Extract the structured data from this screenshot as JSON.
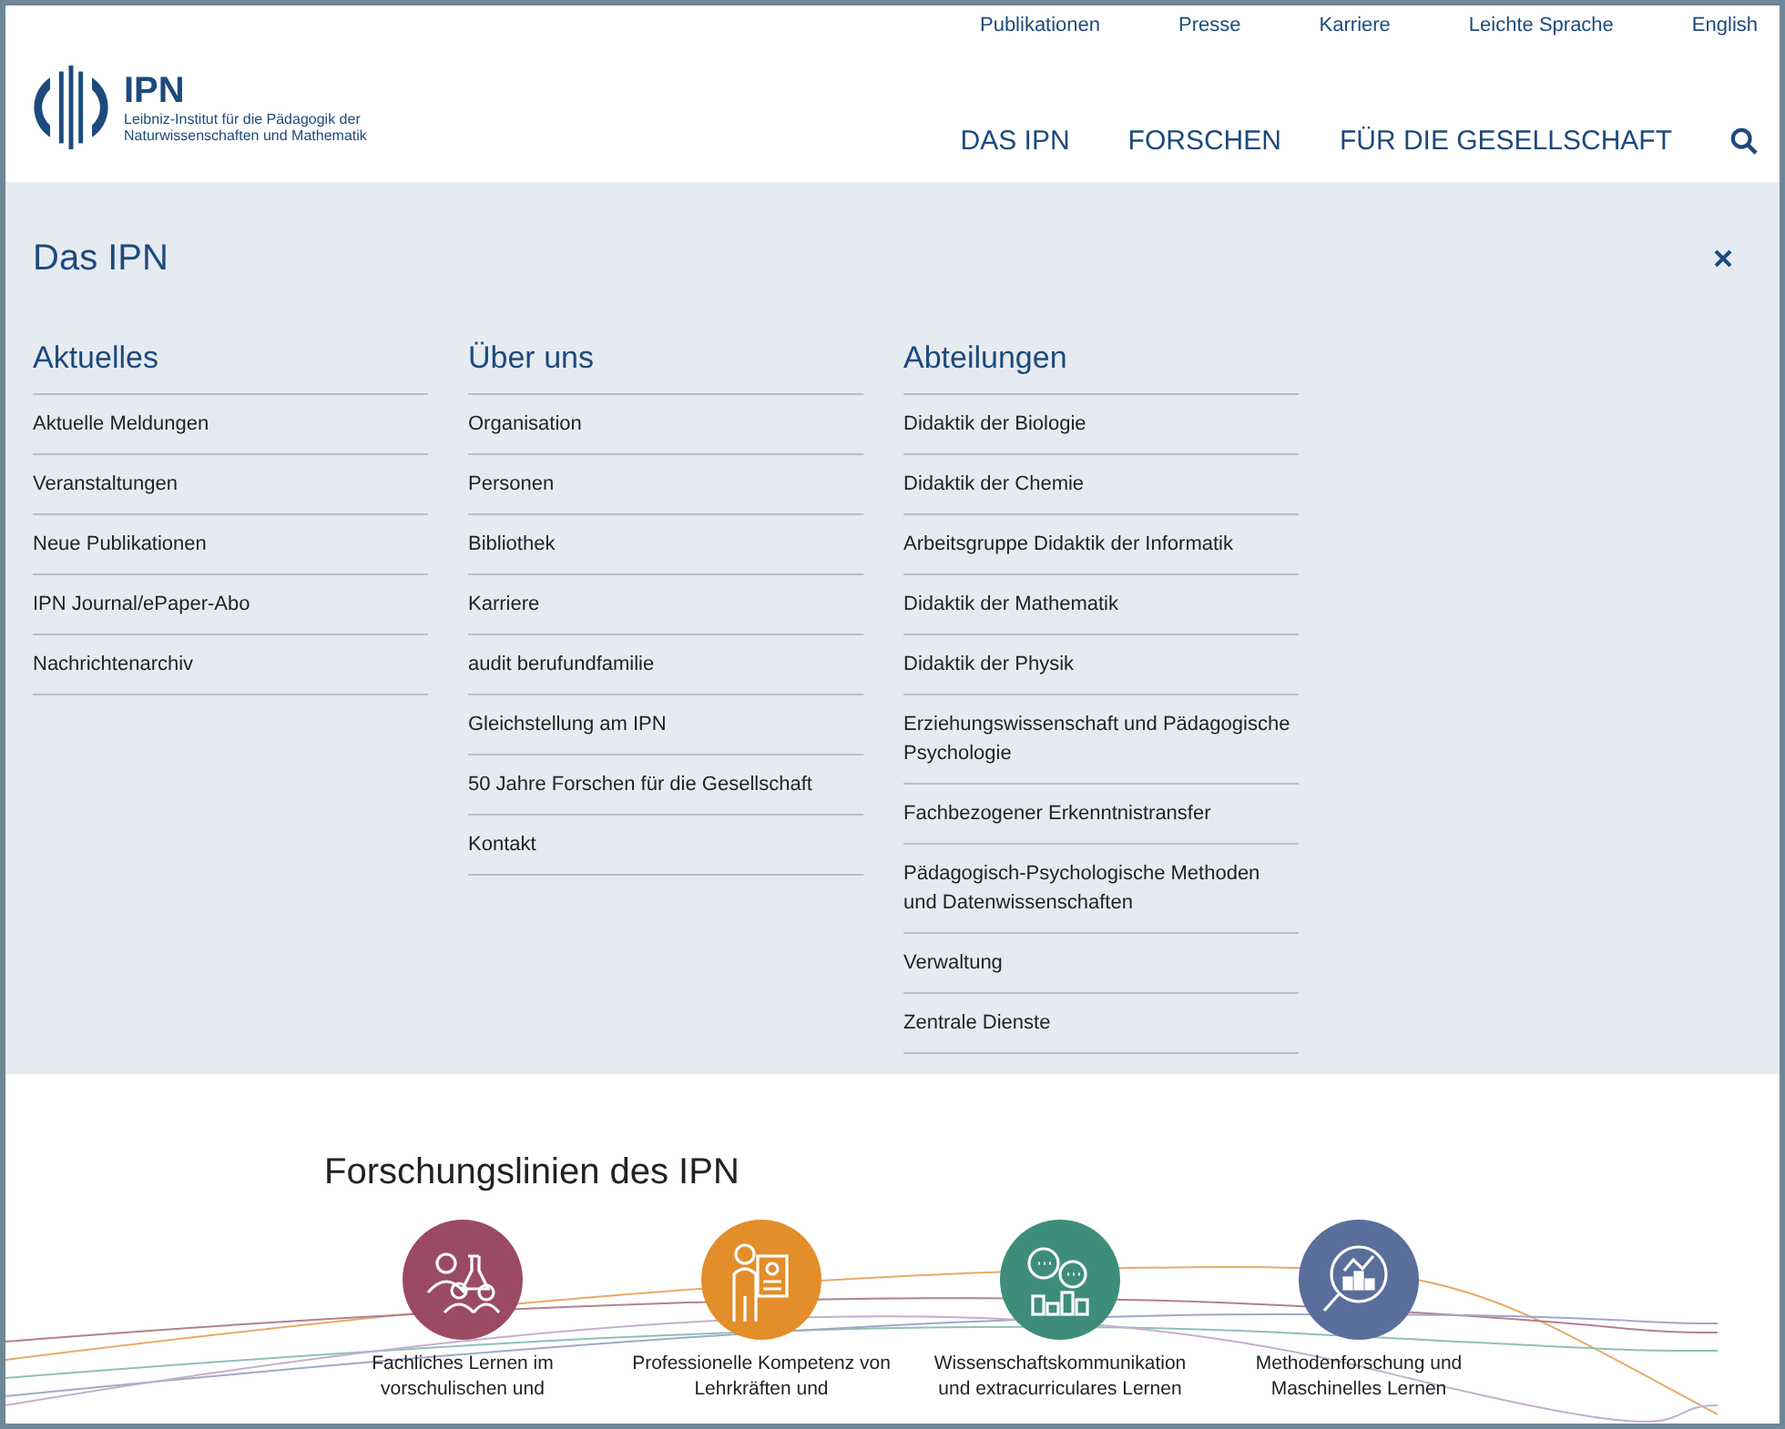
{
  "top_links": [
    "Publikationen",
    "Presse",
    "Karriere",
    "Leichte Sprache",
    "English"
  ],
  "logo": {
    "name": "IPN",
    "subtitle_lines": [
      "Leibniz-Institut für die Pädagogik der",
      "Naturwissenschaften und Mathematik"
    ]
  },
  "main_nav": [
    "DAS IPN",
    "FORSCHEN",
    "FÜR DIE GESELLSCHAFT"
  ],
  "mega_menu": {
    "title": "Das IPN",
    "columns": [
      {
        "heading": "Aktuelles",
        "items": [
          "Aktuelle Meldungen",
          "Veranstaltungen",
          "Neue Publikationen",
          "IPN Journal/ePaper-Abo",
          "Nachrichtenarchiv"
        ]
      },
      {
        "heading": "Über uns",
        "items": [
          "Organisation",
          "Personen",
          "Bibliothek",
          "Karriere",
          "audit berufundfamilie",
          "Gleichstellung am IPN",
          "50 Jahre Forschen für die Gesellschaft",
          "Kontakt"
        ]
      },
      {
        "heading": "Abteilungen",
        "items": [
          "Didaktik der Biologie",
          "Didaktik der Chemie",
          "Arbeitsgruppe Didaktik der Informatik",
          "Didaktik der Mathematik",
          "Didaktik der Physik",
          "Erziehungswissenschaft und Pädagogische Psychologie",
          "Fachbezogener Erkenntnistransfer",
          "Pädagogisch-Psychologische Methoden und Datenwissenschaften",
          "Verwaltung",
          "Zentrale Dienste"
        ]
      }
    ]
  },
  "page": {
    "subheading": "Forschungslinien des IPN",
    "research_lines": [
      {
        "label": "Fachliches Lernen im vorschulischen und",
        "color": "#9b4a63"
      },
      {
        "label": "Professionelle Kompetenz von Lehrkräften und",
        "color": "#e28e2a"
      },
      {
        "label": "Wissenschaftskommunikation und extracurriculares Lernen",
        "color": "#3e8d7b"
      },
      {
        "label": "Methodenforschung und Maschinelles Lernen",
        "color": "#5a6e9b"
      }
    ]
  }
}
